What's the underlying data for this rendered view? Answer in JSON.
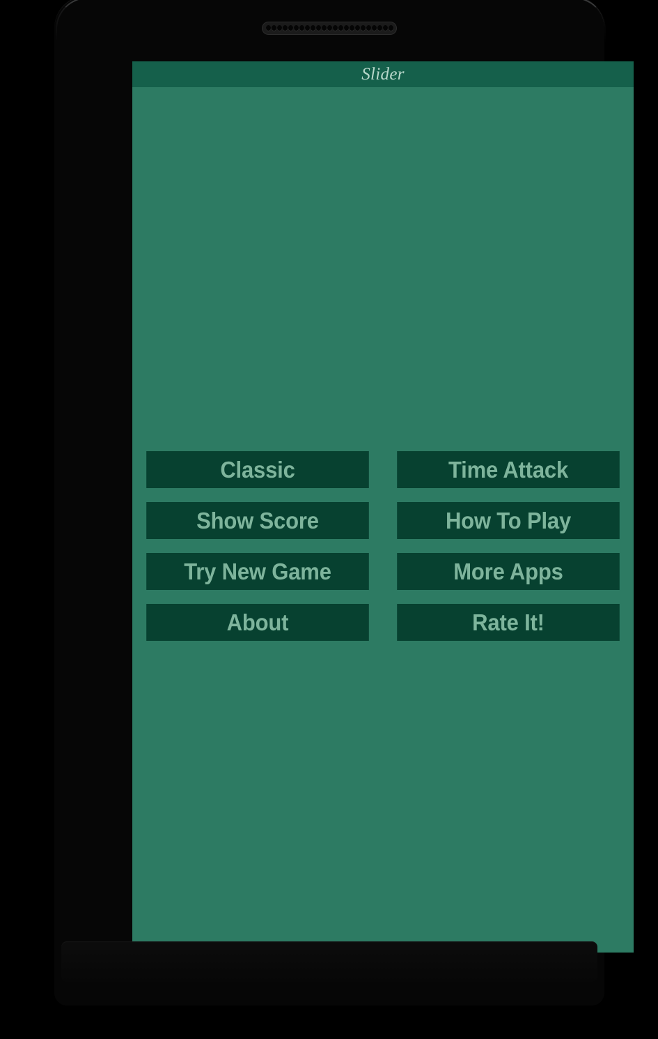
{
  "device": {
    "speaker_icon": "speaker-grille-icon",
    "hole_count": 23
  },
  "app": {
    "title": "Slider"
  },
  "colors": {
    "title_bar": "#15604b",
    "screen_background": "#2d7b63",
    "button_fill": "#074130",
    "button_text": "#7eb49c",
    "title_text": "#b9d8cb",
    "device_frame": "#060606"
  },
  "menu": {
    "buttons": [
      {
        "id": "classic",
        "label": "Classic"
      },
      {
        "id": "time-attack",
        "label": "Time Attack"
      },
      {
        "id": "show-score",
        "label": "Show Score"
      },
      {
        "id": "how-to-play",
        "label": "How To Play"
      },
      {
        "id": "try-new-game",
        "label": "Try New Game"
      },
      {
        "id": "more-apps",
        "label": "More Apps"
      },
      {
        "id": "about",
        "label": "About"
      },
      {
        "id": "rate-it",
        "label": "Rate It!"
      }
    ]
  }
}
